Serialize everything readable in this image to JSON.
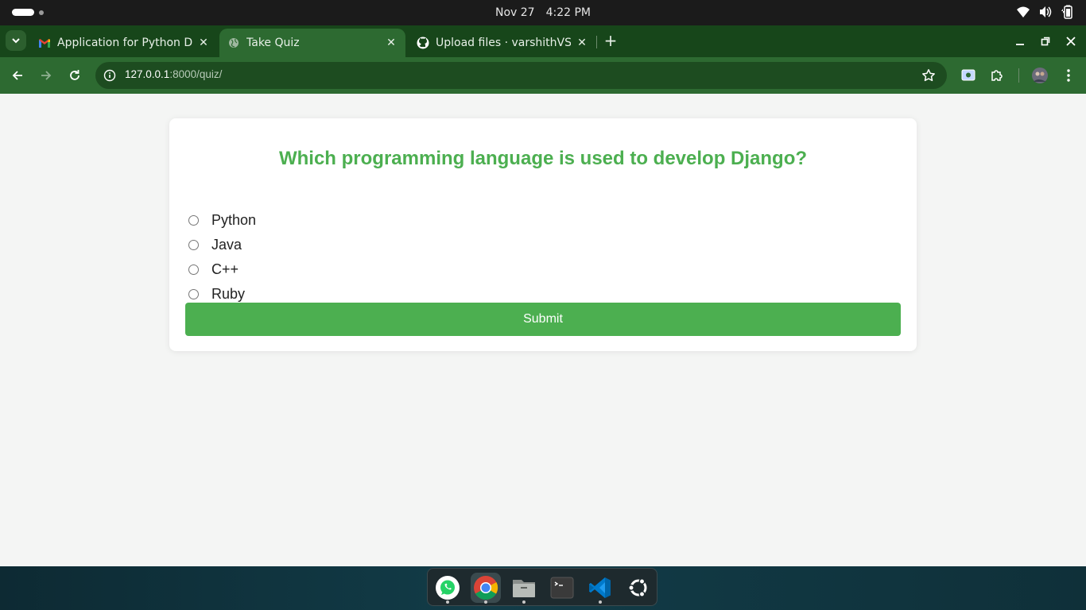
{
  "topbar": {
    "date": "Nov 27",
    "time": "4:22 PM"
  },
  "tabs": [
    {
      "label": "Application for Python D",
      "favicon": "gmail-icon",
      "active": false
    },
    {
      "label": "Take Quiz",
      "favicon": "globe-icon",
      "active": true
    },
    {
      "label": "Upload files · varshithVS/",
      "favicon": "github-icon",
      "active": false
    }
  ],
  "address": {
    "host": "127.0.0.1",
    "path": ":8000/quiz/"
  },
  "quiz": {
    "question": "Which programming language is used to develop Django?",
    "options": [
      "Python",
      "Java",
      "C++",
      "Ruby"
    ],
    "submit_label": "Submit"
  },
  "colors": {
    "accent": "#4caf50",
    "tab_strip": "#17461a",
    "toolbar": "#2d6a31"
  },
  "dock": {
    "apps": [
      "whatsapp-icon",
      "chrome-icon",
      "files-icon",
      "terminal-icon",
      "vscode-icon",
      "ubuntu-icon"
    ]
  }
}
